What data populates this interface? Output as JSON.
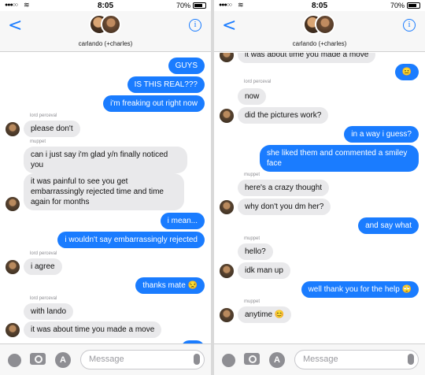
{
  "left": {
    "status": {
      "time": "8:05",
      "battery": "70%"
    },
    "header": {
      "title": "carlando (+charles)",
      "back": "<",
      "info": "i"
    },
    "messages": [
      {
        "dir": "out",
        "text": "GUYS"
      },
      {
        "dir": "out",
        "text": "IS THIS REAL???"
      },
      {
        "dir": "out",
        "text": "i'm freaking out right now"
      },
      {
        "dir": "in",
        "sender": "lord perceval",
        "text": "please don't"
      },
      {
        "dir": "in",
        "sender": "muppet",
        "text": "can i just say i'm glad y/n finally noticed you"
      },
      {
        "dir": "in",
        "text": "it was painful to see you get embarrassingly rejected time and time again for months"
      },
      {
        "dir": "out",
        "text": "i mean..."
      },
      {
        "dir": "out",
        "text": "i wouldn't say embarrassingly rejected"
      },
      {
        "dir": "in",
        "sender": "lord perceval",
        "text": "i agree"
      },
      {
        "dir": "out",
        "text": "thanks mate 😒"
      },
      {
        "dir": "in",
        "sender": "lord perceval",
        "text": "with lando"
      },
      {
        "dir": "in",
        "text": "it was about time you made a move"
      },
      {
        "dir": "out",
        "text": "😊"
      }
    ],
    "input": {
      "placeholder": "Message"
    }
  },
  "right": {
    "status": {
      "time": "8:05",
      "battery": "70%"
    },
    "header": {
      "title": "carlando (+charles)",
      "back": "<",
      "info": "i"
    },
    "messages": [
      {
        "dir": "in",
        "text": "it was about time you made a move"
      },
      {
        "dir": "out",
        "text": "😐"
      },
      {
        "dir": "in",
        "sender": "lord perceval",
        "text": "now"
      },
      {
        "dir": "in",
        "text": "did the pictures work?"
      },
      {
        "dir": "out",
        "text": "in a way i guess?"
      },
      {
        "dir": "out",
        "text": "she liked them and commented a smiley face"
      },
      {
        "dir": "in",
        "sender": "muppet",
        "text": "here's a crazy thought"
      },
      {
        "dir": "in",
        "text": "why don't you dm her?"
      },
      {
        "dir": "out",
        "text": "and say what"
      },
      {
        "dir": "in",
        "sender": "muppet",
        "text": "hello?"
      },
      {
        "dir": "in",
        "text": "idk man up"
      },
      {
        "dir": "out",
        "text": "well thank you for the help 🙄"
      },
      {
        "dir": "in",
        "sender": "muppet",
        "text": "anytime 😊"
      }
    ],
    "input": {
      "placeholder": "Message"
    }
  },
  "colors": {
    "accent": "#1a7cff",
    "incoming": "#e9e9eb"
  }
}
